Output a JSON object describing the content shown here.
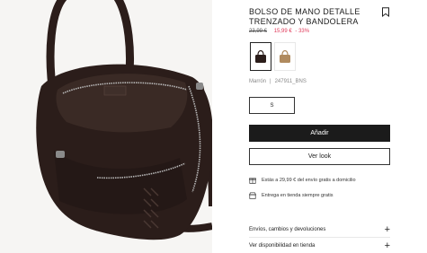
{
  "product": {
    "title_line1": "BOLSO DE MANO DETALLE",
    "title_line2": "TRENZADO Y BANDOLERA",
    "price_old": "23,99 €",
    "price_new": "15,99 €",
    "discount": "- 33%",
    "color_name": "Marrón",
    "reference": "247911_BNS",
    "size_label": "S",
    "swatches": [
      {
        "name": "Marrón",
        "color": "#2b1d1a"
      },
      {
        "name": "Camel",
        "color": "#b08a5e"
      }
    ]
  },
  "actions": {
    "add_label": "Añadir",
    "look_label": "Ver look"
  },
  "info": {
    "shipping_text": "Estás a 29,99 € del envío gratis a domicilio",
    "store_text": "Entrega en tienda siempre gratis"
  },
  "accordion": [
    {
      "label": "Envíos, cambios y devoluciones",
      "icon": "plus-icon"
    },
    {
      "label": "Ver disponibilidad en tienda",
      "icon": "plus-icon"
    }
  ],
  "colors": {
    "accent_sale": "#e03a5a",
    "primary_button": "#1b1b1b",
    "bag": "#2b1d1a"
  }
}
